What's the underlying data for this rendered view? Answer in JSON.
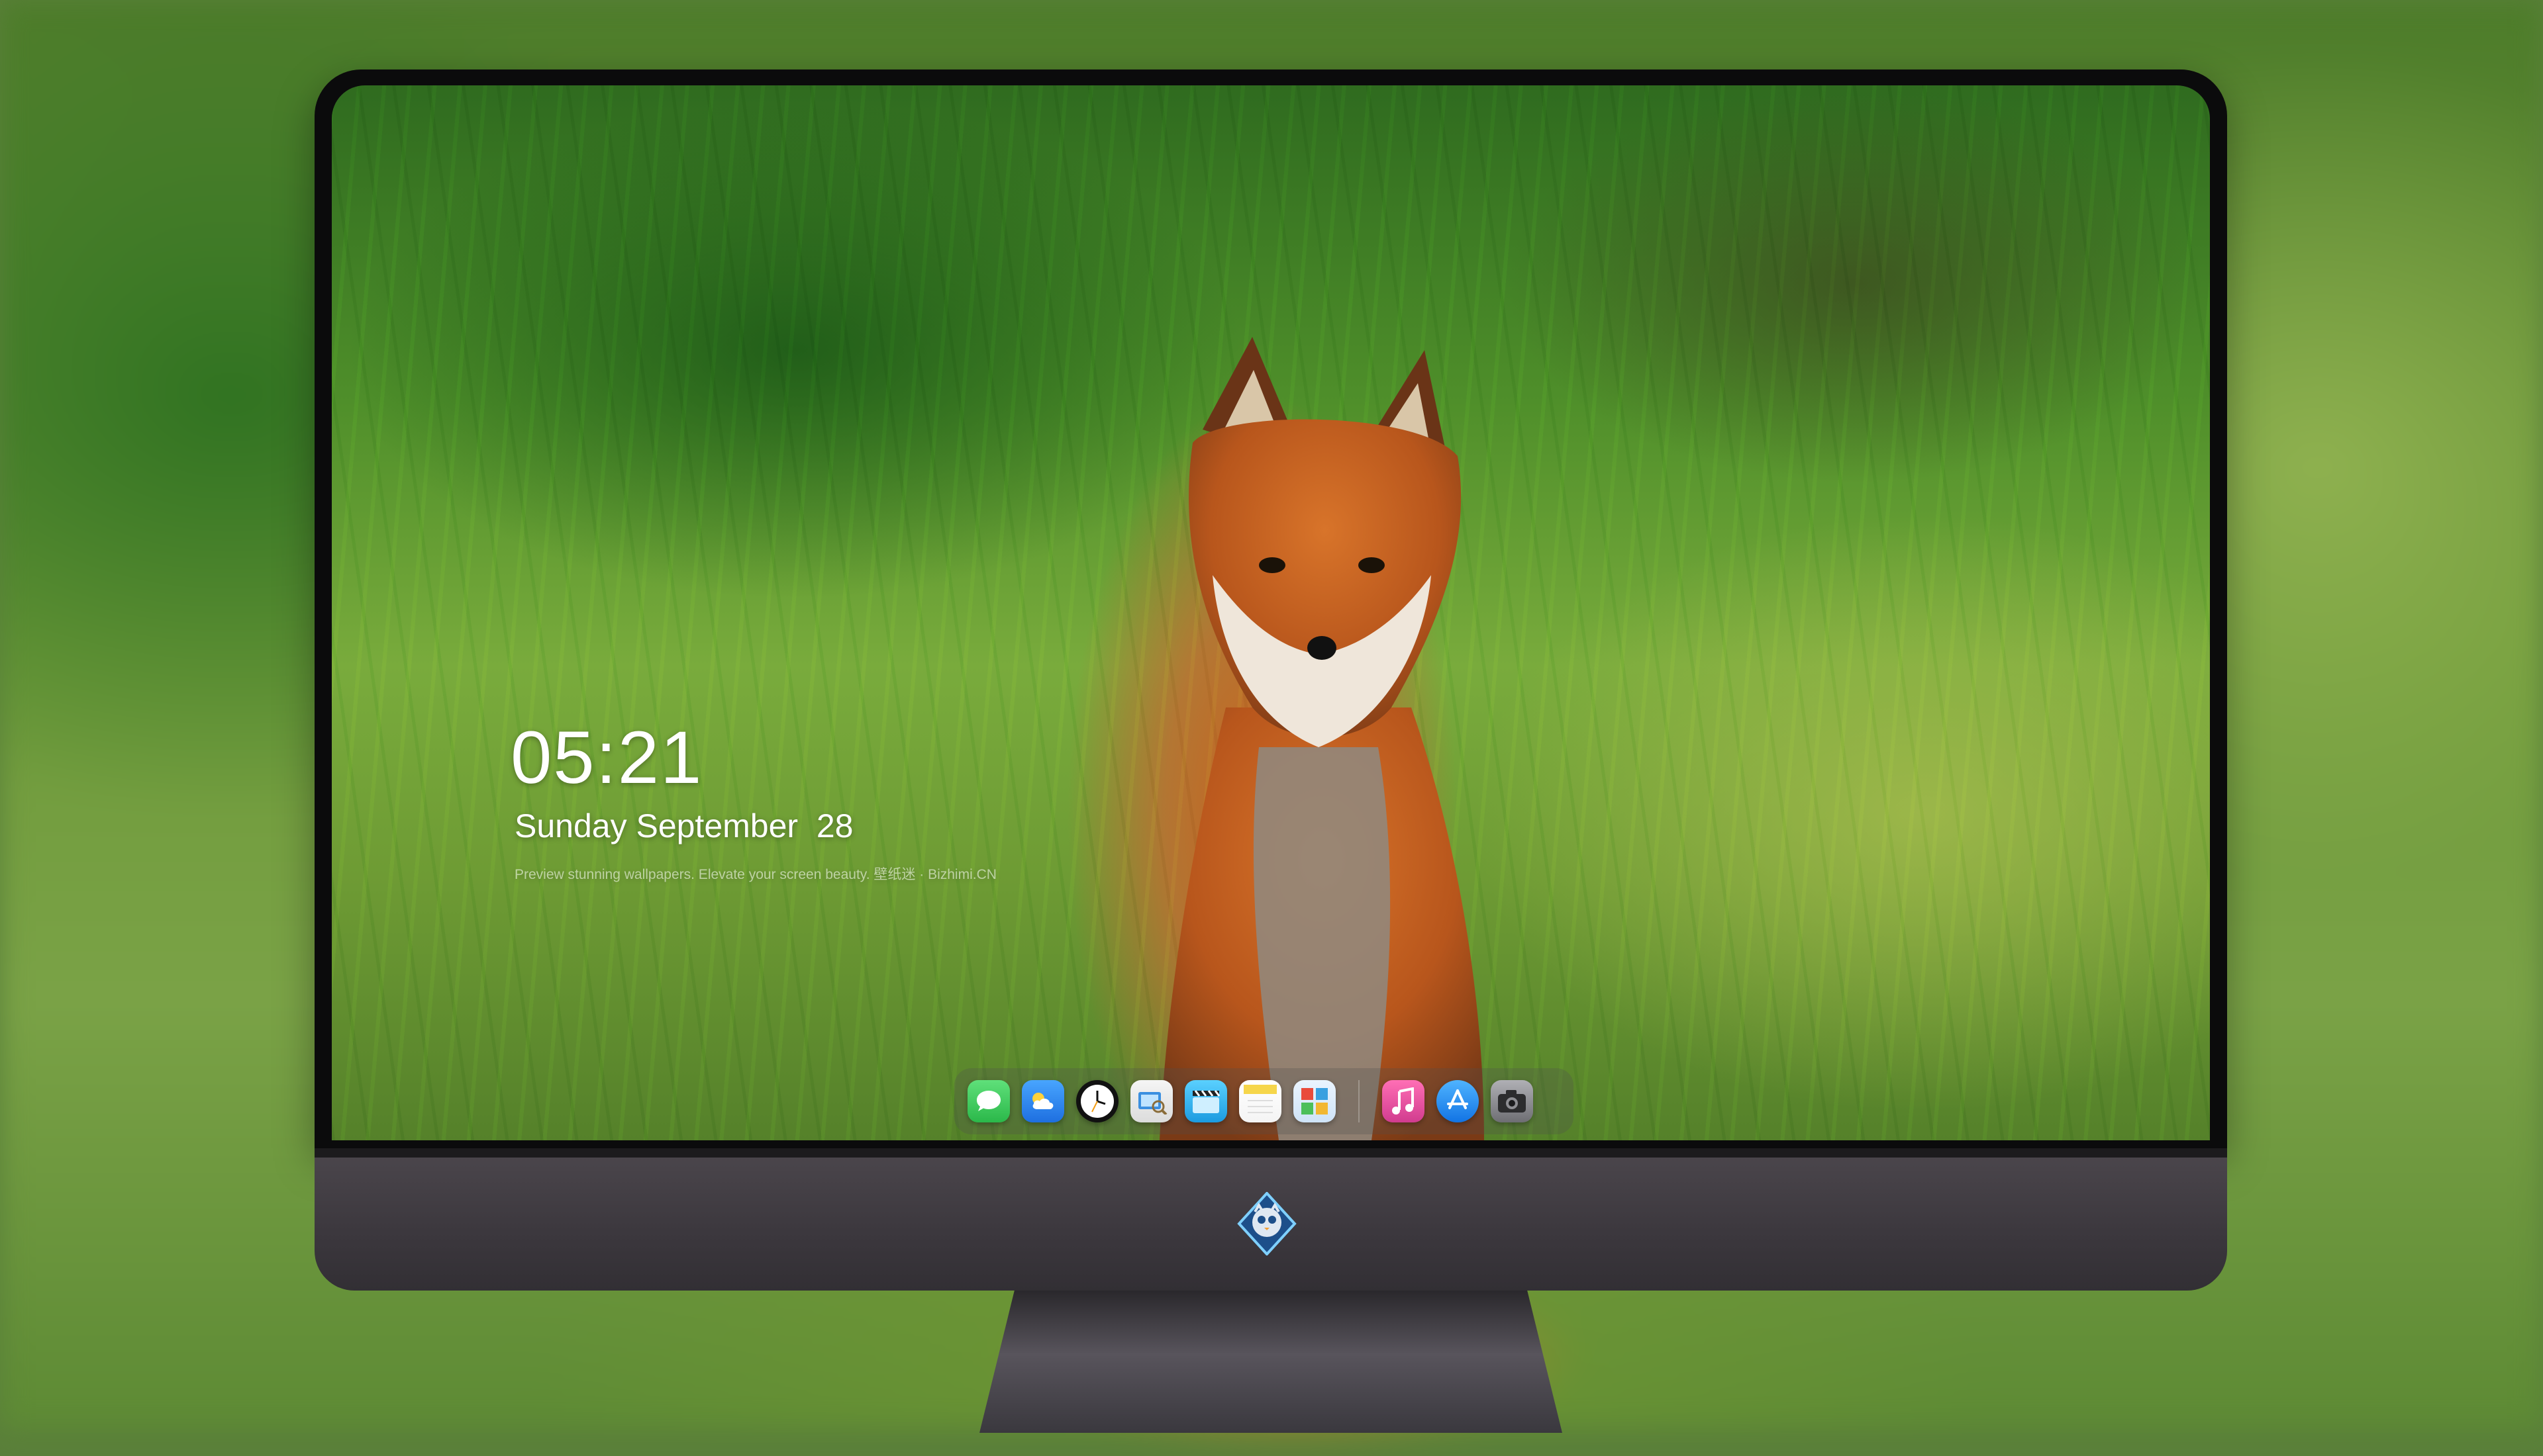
{
  "lockscreen": {
    "time": "05:21",
    "date": "Sunday September  28",
    "tagline": "Preview stunning wallpapers. Elevate your screen beauty. 壁纸迷 · Bizhimi.CN"
  },
  "dock": {
    "items": [
      {
        "name": "messages-icon",
        "color": "#34c759"
      },
      {
        "name": "weather-icon",
        "color": "#2f8ff7"
      },
      {
        "name": "clock-icon",
        "color": "#111111"
      },
      {
        "name": "preview-icon",
        "color": "#4a90e2"
      },
      {
        "name": "clips-icon",
        "color": "#39b8f5"
      },
      {
        "name": "notes-icon",
        "color": "#f6d64b"
      },
      {
        "name": "photo-browser-icon",
        "color": "#3a8ad8"
      },
      {
        "name": "music-icon",
        "color": "#f24fa0"
      },
      {
        "name": "app-store-icon",
        "color": "#1c8cf0"
      },
      {
        "name": "camera-icon",
        "color": "#8e8e93"
      }
    ]
  },
  "monitor": {
    "logo": "owl-mascot-logo"
  }
}
